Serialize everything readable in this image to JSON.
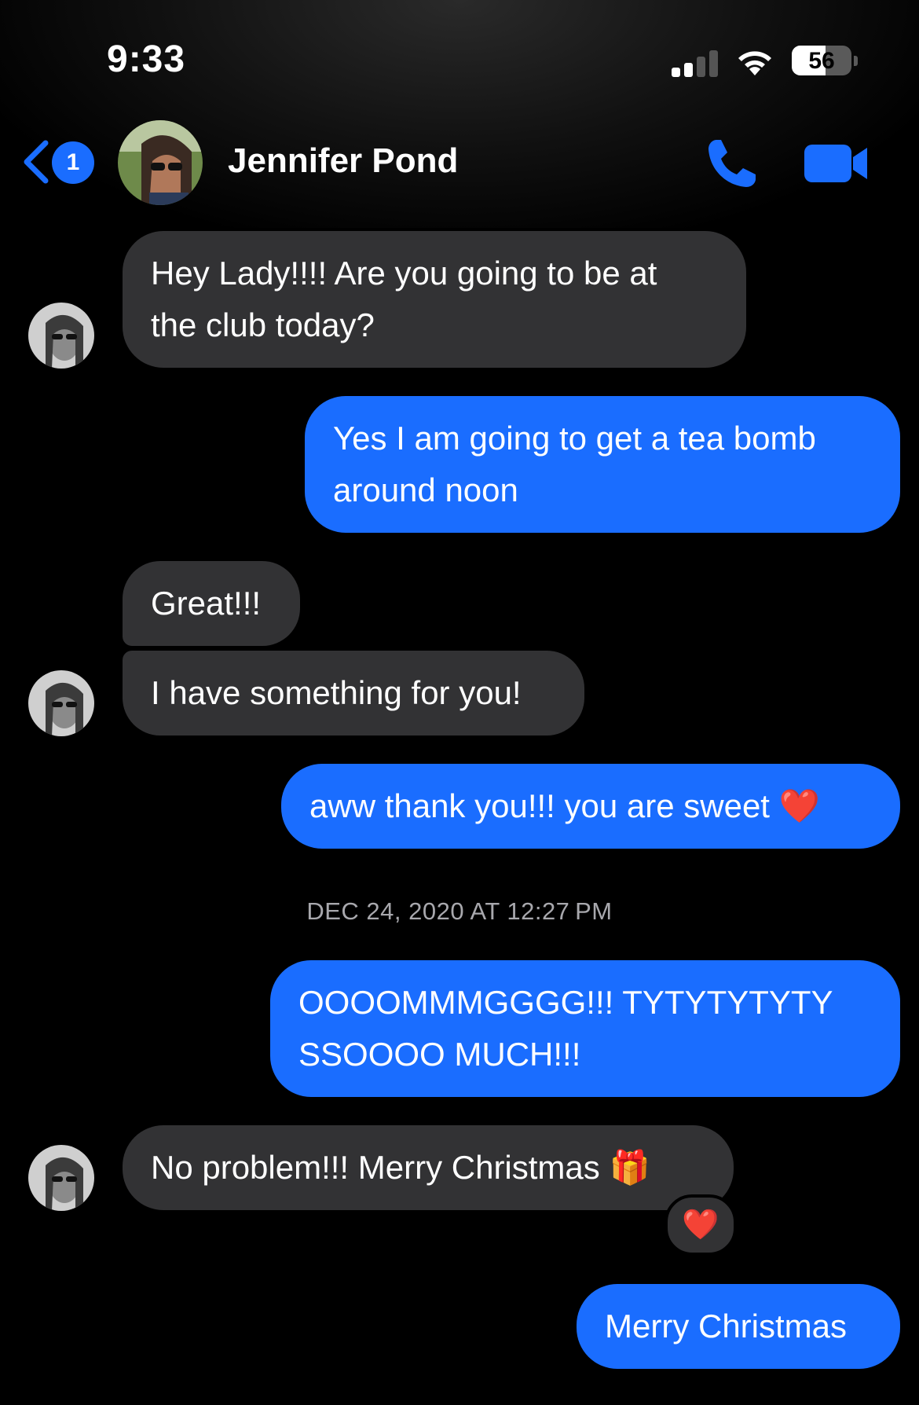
{
  "status_bar": {
    "time": "9:33",
    "battery": "56",
    "battery_level": 0.56
  },
  "header": {
    "back_badge": "1",
    "contact_name": "Jennifer Pond"
  },
  "messages": [
    {
      "from": "them",
      "lines": [
        "Hey Lady!!!! Are you going to be at",
        "the club today?"
      ]
    },
    {
      "from": "me",
      "lines": [
        "Yes I am going to get a tea bomb",
        "around noon"
      ]
    },
    {
      "from": "them",
      "lines": [
        "Great!!!"
      ]
    },
    {
      "from": "them",
      "lines": [
        "I have something for you!"
      ]
    },
    {
      "from": "me",
      "lines": [
        "aww thank you!!! you are sweet ❤️"
      ]
    },
    {
      "from": "me",
      "lines": [
        "OOOOMMMGGGG!!! TYTYTYTYTY",
        "SSOOOO MUCH!!!"
      ]
    },
    {
      "from": "them",
      "lines": [
        "No problem!!! Merry Christmas 🎁"
      ],
      "reaction": "❤️"
    },
    {
      "from": "me",
      "lines": [
        "Merry Christmas"
      ]
    }
  ],
  "timestamp": "DEC 24, 2020 AT 12:27 PM",
  "colors": {
    "outgoing": "#1a6dff",
    "incoming": "#323234",
    "accent": "#1a6dff"
  },
  "icons": [
    "back-chevron-icon",
    "phone-icon",
    "video-camera-icon",
    "wifi-icon",
    "signal-icon",
    "battery-icon"
  ]
}
